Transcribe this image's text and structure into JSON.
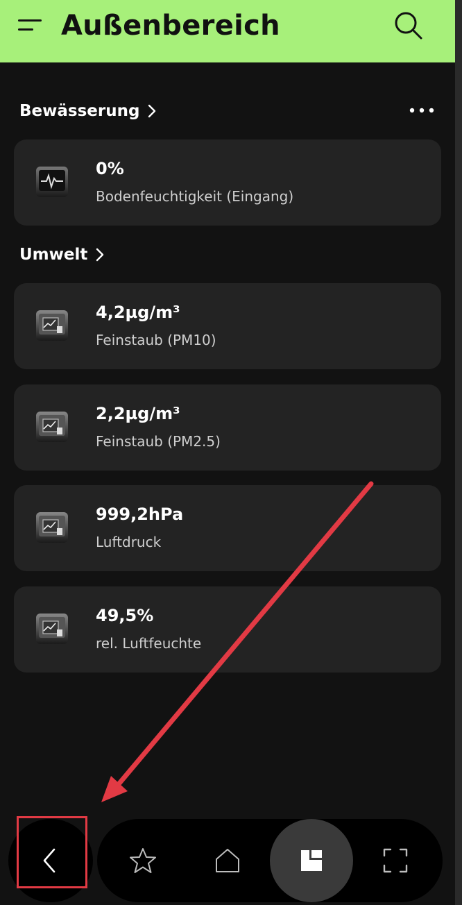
{
  "header": {
    "title": "Außenbereich",
    "menu_icon": "menu-icon",
    "search_icon": "search-icon",
    "color": "#a7f07a"
  },
  "sections": [
    {
      "title": "Bewässerung",
      "items": [
        {
          "value": "0%",
          "label": "Bodenfeuchtigkeit (Eingang)",
          "icon": "sensor-pulse-icon"
        }
      ]
    },
    {
      "title": "Umwelt",
      "items": [
        {
          "value": "4,2µg/m³",
          "label": "Feinstaub (PM10)",
          "icon": "sensor-chart-icon"
        },
        {
          "value": "2,2µg/m³",
          "label": "Feinstaub (PM2.5)",
          "icon": "sensor-chart-icon"
        },
        {
          "value": "999,2hPa",
          "label": "Luftdruck",
          "icon": "sensor-chart-icon"
        },
        {
          "value": "49,5%",
          "label": "rel. Luftfeuchte",
          "icon": "sensor-chart-icon"
        }
      ]
    }
  ],
  "bottom_nav": {
    "back": "back-icon",
    "items": [
      "star-icon",
      "home-icon",
      "dashboard-icon",
      "scan-icon"
    ],
    "active": "dashboard-icon"
  },
  "annotation": {
    "color": "#e23a44"
  }
}
